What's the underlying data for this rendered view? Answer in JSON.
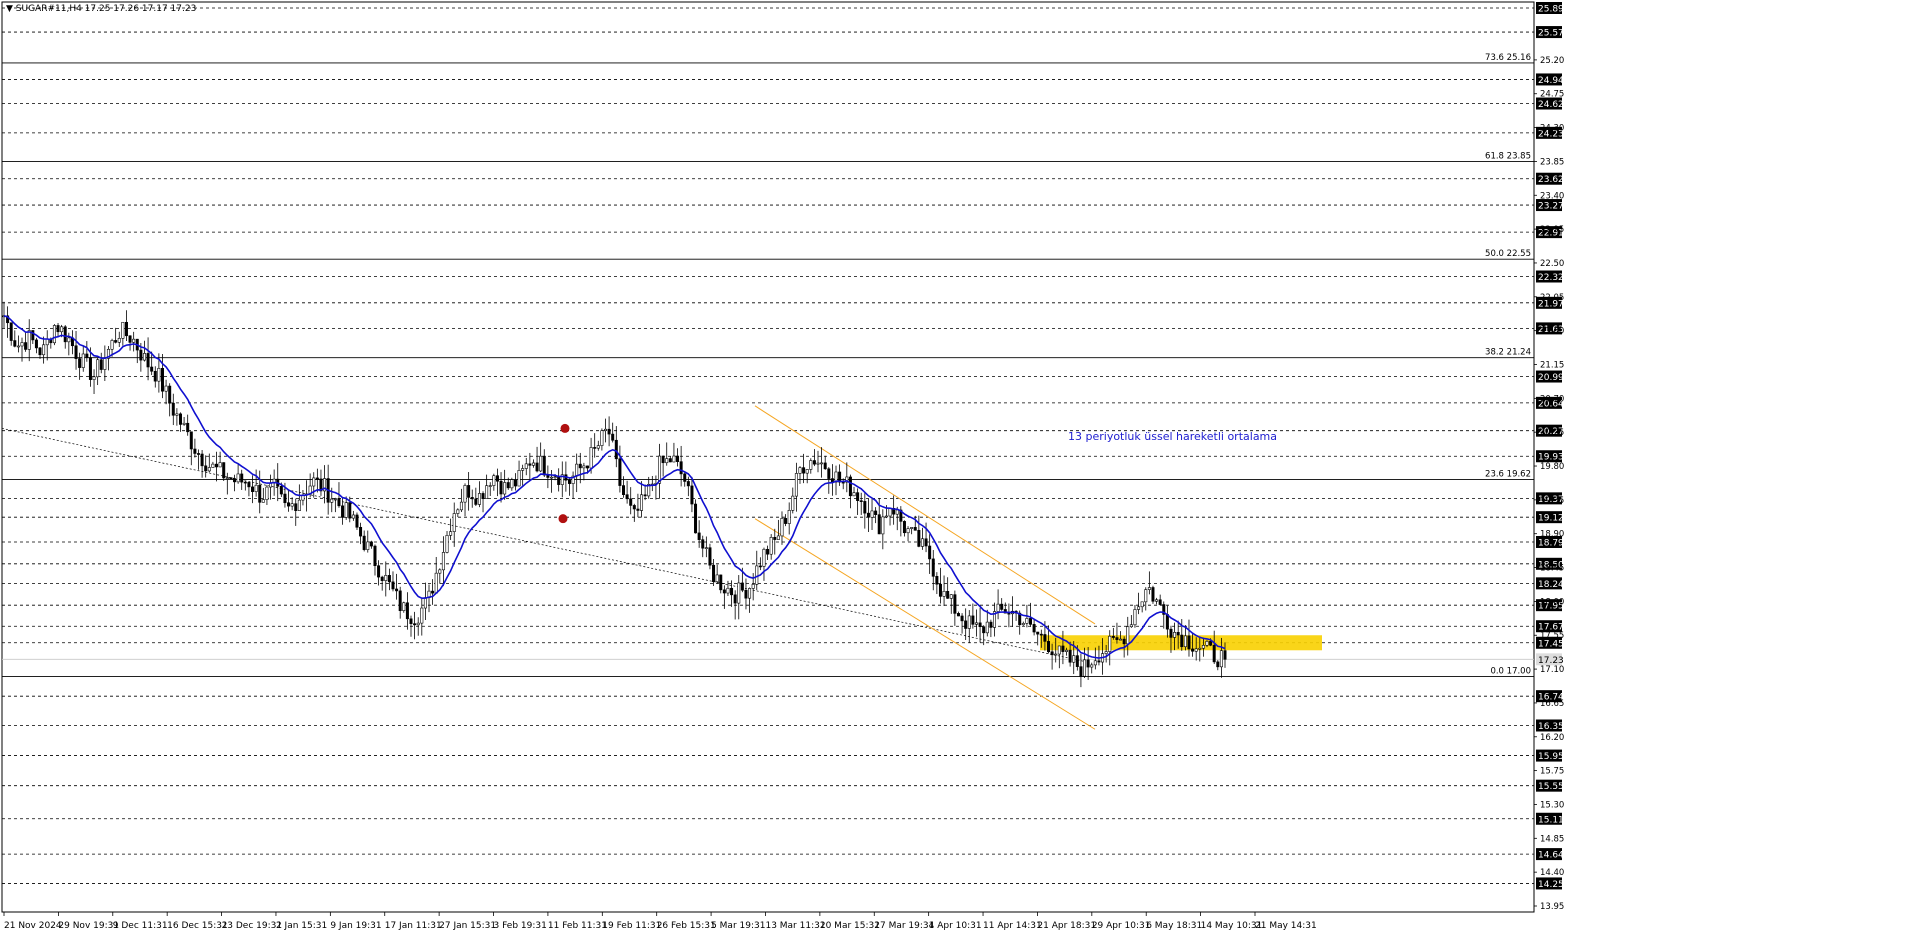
{
  "header": {
    "symbol_line": "▼ SUGAR#11,H4  17.25 17.26 17.17 17.23"
  },
  "annotation_text": "13 periyotluk üssel hareketli ortalama",
  "colors": {
    "background": "#ffffff",
    "grid": "#000000",
    "candle": "#000000",
    "ema": "#1010d0",
    "channel": "#f5a623",
    "zone": "#f8d000",
    "marker": "#b01010",
    "annotation": "#2020d0",
    "price_box": "#000000",
    "current_box": "#dddddd"
  },
  "chart_data": {
    "type": "candlestick",
    "symbol": "SUGAR#11",
    "timeframe": "H4",
    "ylim": [
      13.95,
      25.89
    ],
    "current_price": 17.23,
    "ohlc_header": {
      "open": 17.25,
      "high": 17.26,
      "low": 17.17,
      "close": 17.23
    },
    "x_ticks": [
      "21 Nov 2024",
      "29 Nov 19:31",
      "9 Dec 11:31",
      "16 Dec 15:31",
      "23 Dec 19:31",
      "2 Jan 15:31",
      "9 Jan 19:31",
      "17 Jan 11:31",
      "27 Jan 15:31",
      "3 Feb 19:31",
      "11 Feb 11:31",
      "19 Feb 11:31",
      "26 Feb 15:31",
      "5 Mar 19:31",
      "13 Mar 11:31",
      "20 Mar 15:31",
      "27 Mar 19:31",
      "4 Apr 10:31",
      "11 Apr 14:31",
      "21 Apr 18:31",
      "29 Apr 10:31",
      "6 May 18:31",
      "14 May 10:31",
      "21 May 14:31"
    ],
    "price_scale_labels": [
      "25.20",
      "24.75",
      "24.30",
      "23.85",
      "23.40",
      "22.95",
      "22.50",
      "22.05",
      "21.60",
      "21.15",
      "20.70",
      "20.25",
      "19.80",
      "19.35",
      "18.90",
      "18.45",
      "18.00",
      "17.55",
      "17.10",
      "16.65",
      "16.20",
      "15.75",
      "15.30",
      "14.85",
      "14.40",
      "13.95"
    ],
    "horizontal_levels": [
      "25.89",
      "25.57",
      "24.94",
      "24.62",
      "24.23",
      "23.62",
      "23.27",
      "22.91",
      "22.32",
      "21.97",
      "21.63",
      "20.99",
      "20.64",
      "20.27",
      "19.93",
      "19.37",
      "19.12",
      "18.79",
      "18.50",
      "18.24",
      "17.95",
      "17.67",
      "17.45",
      "17.23",
      "16.74",
      "16.35",
      "15.95",
      "15.55",
      "15.11",
      "14.64",
      "14.25"
    ],
    "fibonacci": [
      {
        "label": "73.6 25.16",
        "level": 25.16
      },
      {
        "label": "61.8 23.85",
        "level": 23.85
      },
      {
        "label": "50.0 22.55",
        "level": 22.55
      },
      {
        "label": "38.2 21.24",
        "level": 21.24
      },
      {
        "label": "23.6 19.62",
        "level": 19.62
      },
      {
        "label": "0.0 17.00",
        "level": 17.0
      }
    ],
    "close_path": [
      21.8,
      21.4,
      21.5,
      21.3,
      21.7,
      21.5,
      21.2,
      21.0,
      21.3,
      21.6,
      21.5,
      21.2,
      21.0,
      20.6,
      20.3,
      20.0,
      19.8,
      19.7,
      19.6,
      19.6,
      19.4,
      19.5,
      19.2,
      19.4,
      19.6,
      19.5,
      19.3,
      19.1,
      18.8,
      18.5,
      18.2,
      17.9,
      17.8,
      18.0,
      18.6,
      19.2,
      19.5,
      19.4,
      19.7,
      19.5,
      19.6,
      19.9,
      19.8,
      19.7,
      19.6,
      19.8,
      20.0,
      20.3,
      19.5,
      19.1,
      19.4,
      19.8,
      19.9,
      19.6,
      18.9,
      18.4,
      18.2,
      18.1,
      18.2,
      18.6,
      18.8,
      19.2,
      19.8,
      19.9,
      19.8,
      19.6,
      19.5,
      19.3,
      19.0,
      19.3,
      19.0,
      18.8,
      18.6,
      18.1,
      17.9,
      17.7,
      17.6,
      17.8,
      17.9,
      17.8,
      17.6,
      17.5,
      17.3,
      17.2,
      17.1,
      17.3,
      17.4,
      17.5,
      17.9,
      18.2,
      17.9,
      17.6,
      17.5,
      17.4,
      17.3,
      17.23
    ],
    "ema_period": 13,
    "rebound_markers": [
      20.3,
      19.1
    ],
    "channel_upper": {
      "start": 20.6,
      "end": 17.7
    },
    "channel_lower": {
      "start": 19.1,
      "end": 16.3
    },
    "trendline": {
      "start": 20.3,
      "end": 17.2
    },
    "support_zone": {
      "low": 17.35,
      "high": 17.55
    }
  }
}
